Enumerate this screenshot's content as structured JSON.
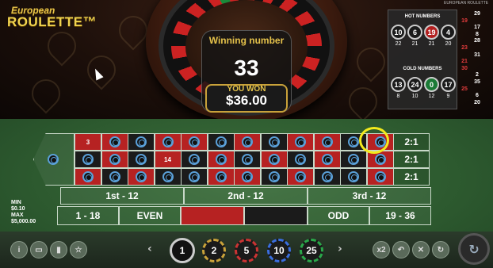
{
  "logo": {
    "line1": "European",
    "line2": "ROULETTE™"
  },
  "window_title": "EUROPEAN ROULETTE",
  "result": {
    "label": "Winning number",
    "number": "33",
    "won_label": "YOU WON",
    "won_amount": "$36.00"
  },
  "stats": {
    "hot_title": "HOT NUMBERS",
    "hot": [
      {
        "n": "10",
        "c": "22",
        "color": "black"
      },
      {
        "n": "6",
        "c": "21",
        "color": "black"
      },
      {
        "n": "19",
        "c": "21",
        "color": "red"
      },
      {
        "n": "4",
        "c": "20",
        "color": "black"
      }
    ],
    "cold_title": "COLD NUMBERS",
    "cold": [
      {
        "n": "13",
        "c": "8",
        "color": "black"
      },
      {
        "n": "24",
        "c": "10",
        "color": "black"
      },
      {
        "n": "0",
        "c": "12",
        "color": "green"
      },
      {
        "n": "17",
        "c": "9",
        "color": "black"
      }
    ]
  },
  "history": [
    {
      "v": "29",
      "color": "white",
      "side": "right"
    },
    {
      "v": "19",
      "color": "red",
      "side": "left"
    },
    {
      "v": "17",
      "color": "white",
      "side": "right"
    },
    {
      "v": "8",
      "color": "white",
      "side": "right"
    },
    {
      "v": "28",
      "color": "white",
      "side": "right"
    },
    {
      "v": "23",
      "color": "red",
      "side": "left"
    },
    {
      "v": "31",
      "color": "white",
      "side": "right"
    },
    {
      "v": "21",
      "color": "red",
      "side": "left"
    },
    {
      "v": "30",
      "color": "red",
      "side": "left"
    },
    {
      "v": "2",
      "color": "white",
      "side": "right"
    },
    {
      "v": "35",
      "color": "white",
      "side": "right"
    },
    {
      "v": "25",
      "color": "red",
      "side": "left"
    },
    {
      "v": "6",
      "color": "white",
      "side": "right"
    },
    {
      "v": "20",
      "color": "white",
      "side": "right"
    }
  ],
  "table": {
    "cells": [
      {
        "label": "3",
        "color": "red"
      },
      {
        "label": "",
        "color": "red"
      },
      {
        "label": "",
        "color": "black"
      },
      {
        "label": "",
        "color": "red"
      },
      {
        "label": "",
        "color": "red"
      },
      {
        "label": "",
        "color": "black"
      },
      {
        "label": "",
        "color": "red"
      },
      {
        "label": "",
        "color": "black"
      },
      {
        "label": "",
        "color": "red"
      },
      {
        "label": "",
        "color": "red"
      },
      {
        "label": "",
        "color": "black"
      },
      {
        "label": "",
        "color": "red"
      },
      {
        "label": "",
        "color": "black"
      },
      {
        "label": "",
        "color": "red"
      },
      {
        "label": "",
        "color": "black"
      },
      {
        "label": "14",
        "color": "red"
      },
      {
        "label": "",
        "color": "black"
      },
      {
        "label": "",
        "color": "red"
      },
      {
        "label": "",
        "color": "black"
      },
      {
        "label": "",
        "color": "red"
      },
      {
        "label": "",
        "color": "black"
      },
      {
        "label": "",
        "color": "red"
      },
      {
        "label": "",
        "color": "black"
      },
      {
        "label": "",
        "color": "red"
      },
      {
        "label": "",
        "color": "red"
      },
      {
        "label": "",
        "color": "black"
      },
      {
        "label": "",
        "color": "red"
      },
      {
        "label": "",
        "color": "black"
      },
      {
        "label": "",
        "color": "black"
      },
      {
        "label": "",
        "color": "red"
      },
      {
        "label": "",
        "color": "red"
      },
      {
        "label": "",
        "color": "black"
      },
      {
        "label": "",
        "color": "red"
      },
      {
        "label": "",
        "color": "black"
      },
      {
        "label": "",
        "color": "black"
      },
      {
        "label": "",
        "color": "red"
      }
    ],
    "columns": [
      "2:1",
      "2:1",
      "2:1"
    ],
    "dozens": [
      "1st - 12",
      "2nd - 12",
      "3rd - 12"
    ],
    "outside": {
      "low": "1 - 18",
      "even": "EVEN",
      "odd": "ODD",
      "high": "19 - 36"
    }
  },
  "limits": {
    "min_label": "MIN",
    "min": "$0.10",
    "max_label": "MAX",
    "max": "$5,000.00"
  },
  "chips": [
    "1",
    "2",
    "5",
    "10",
    "25"
  ],
  "controls": {
    "info": "i",
    "double": "x2"
  }
}
